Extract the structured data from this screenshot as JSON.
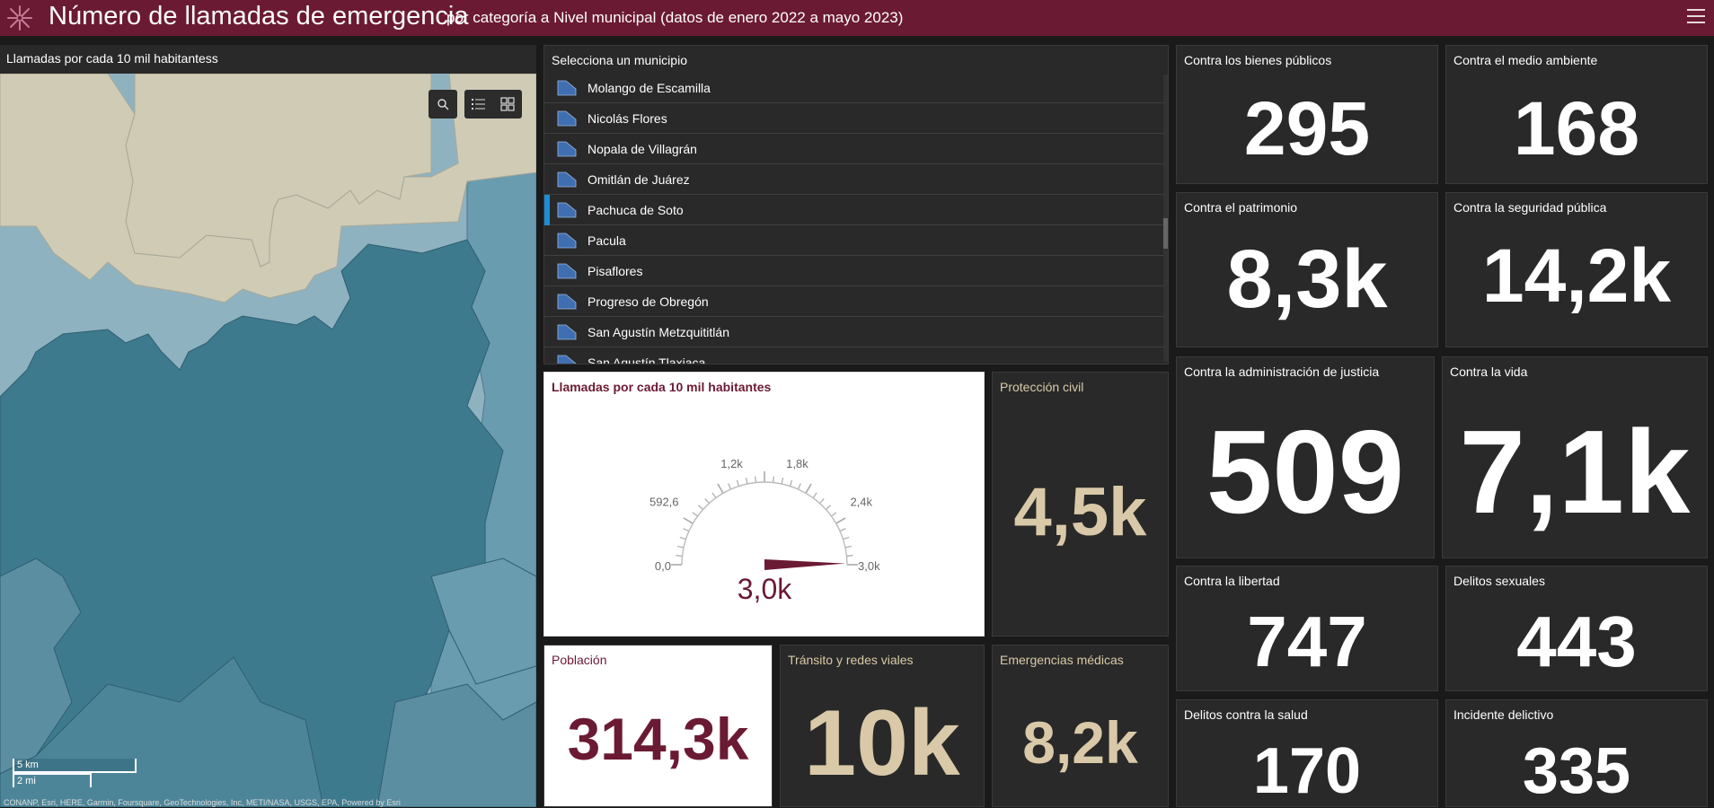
{
  "header": {
    "title": "Número de llamadas de emergencia",
    "subtitle": "por categoría a Nivel municipal (datos de enero 2022 a mayo 2023)",
    "brand_color": "#6b1a33"
  },
  "map": {
    "title": "Llamadas por cada 10 mil habitantess",
    "scale_km": "5 km",
    "scale_mi": "2 mi",
    "attribution": "CONANP, Esri, HERE, Garmin, Foursquare, GeoTechnologies, Inc, METI/NASA, USGS, EPA, Powered by Esri",
    "buttons": [
      "search-icon",
      "legend-icon",
      "basemap-icon"
    ]
  },
  "municipio_list": {
    "title": "Selecciona un municipio",
    "items": [
      "Molango de Escamilla",
      "Nicolás Flores",
      "Nopala de Villagrán",
      "Omitlán de Juárez",
      "Pachuca de Soto",
      "Pacula",
      "Pisaflores",
      "Progreso de Obregón",
      "San Agustín Metzquititlán",
      "San Agustín Tlaxiaca"
    ],
    "selected": "Pachuca de Soto"
  },
  "gauge": {
    "title": "Llamadas por cada 10 mil habitantes",
    "value_label": "3,0k",
    "tick_labels": [
      "0,0",
      "592,6",
      "1,2k",
      "1,8k",
      "2,4k",
      "3,0k"
    ],
    "value_fraction": 0.995,
    "color": "#6b1a33"
  },
  "indicators": {
    "bienes_publicos": {
      "title": "Contra los bienes públicos",
      "value": "295"
    },
    "medio_ambiente": {
      "title": "Contra el medio ambiente",
      "value": "168"
    },
    "patrimonio": {
      "title": "Contra el patrimonio",
      "value": "8,3k"
    },
    "seguridad_publica": {
      "title": "Contra la seguridad pública",
      "value": "14,2k"
    },
    "admin_justicia": {
      "title": "Contra la administración de justicia",
      "value": "509"
    },
    "vida": {
      "title": "Contra la vida",
      "value": "7,1k"
    },
    "libertad": {
      "title": "Contra la libertad",
      "value": "747"
    },
    "sexuales": {
      "title": "Delitos sexuales",
      "value": "443"
    },
    "salud": {
      "title": "Delitos contra la salud",
      "value": "170"
    },
    "incidente": {
      "title": "Incidente delictivo",
      "value": "335"
    },
    "proteccion_civil": {
      "title": "Protección civil",
      "value": "4,5k"
    },
    "poblacion": {
      "title": "Población",
      "value": "314,3k"
    },
    "transito": {
      "title": "Tránsito y redes viales",
      "value": "10k"
    },
    "emergencias_medicas": {
      "title": "Emergencias médicas",
      "value": "8,2k"
    }
  },
  "colors": {
    "gold": "#d9c9a8",
    "panel": "#292929",
    "selection": "#1a8ed8",
    "map_dark": "#3e7a8e",
    "map_light": "#8fb2c0",
    "map_beige": "#cfcbb5"
  }
}
